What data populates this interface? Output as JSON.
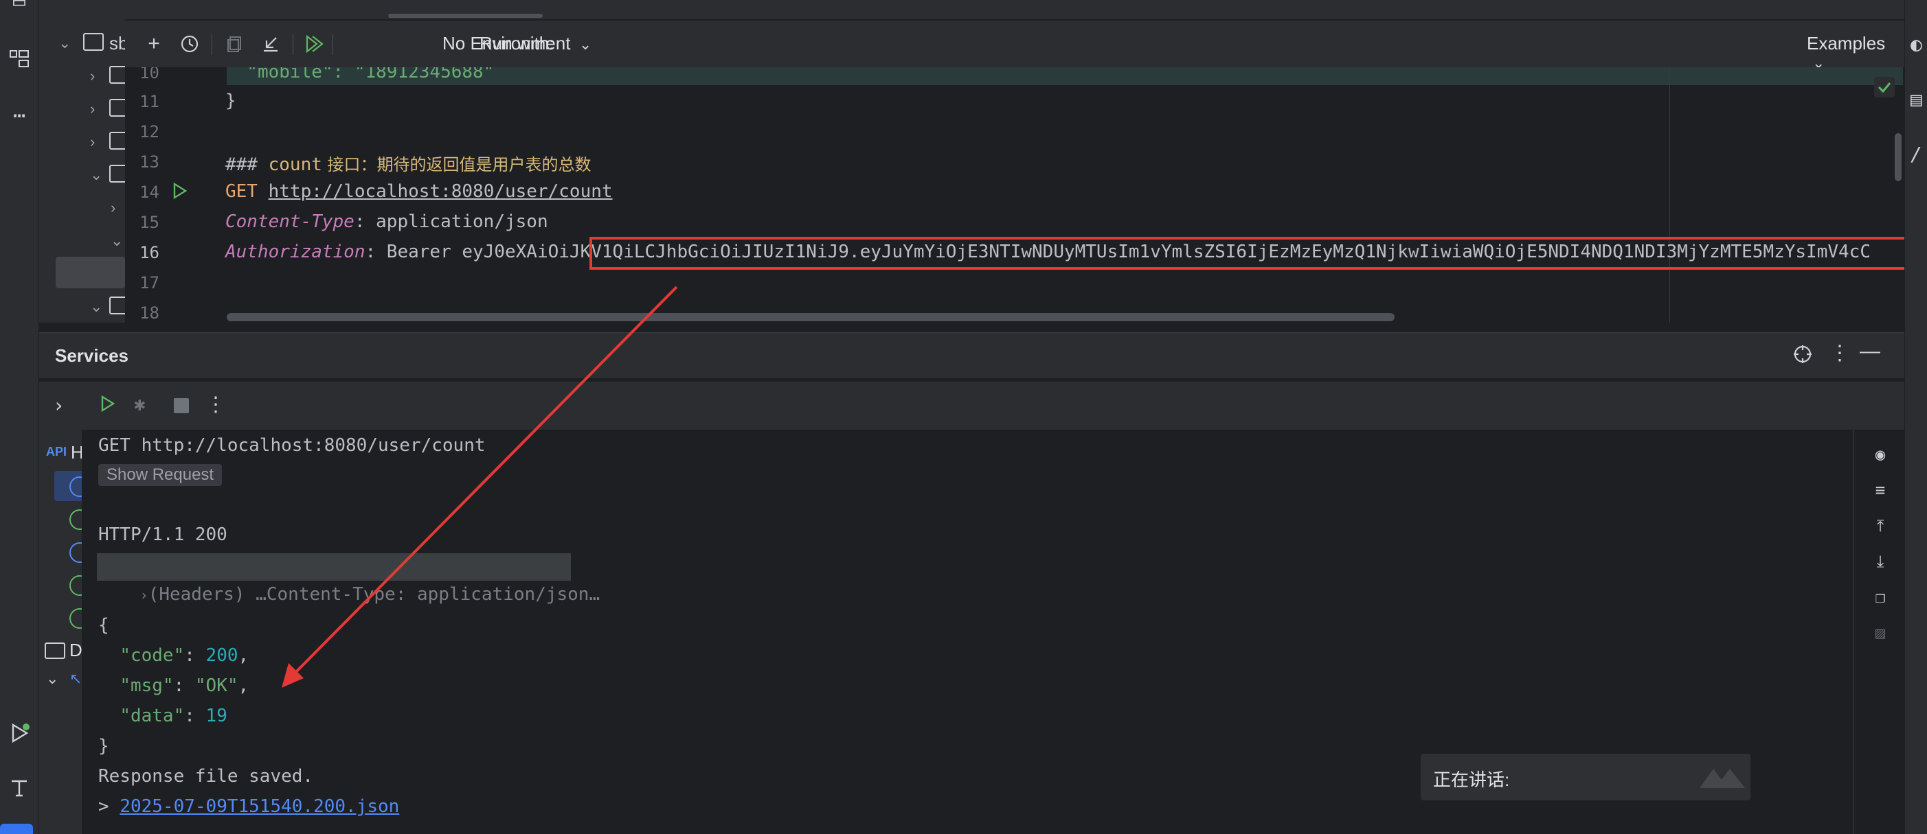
{
  "toolbar": {
    "run_with_label": "Run with:",
    "environment": "No Environment",
    "examples_label": "Examples"
  },
  "project_tree": {
    "root_label": "sb",
    "items": [
      {
        "label": "D"
      }
    ]
  },
  "editor": {
    "lines": [
      {
        "num": "10",
        "text": "  \"mobile\": \"18912345688\""
      },
      {
        "num": "11",
        "text": "}"
      },
      {
        "num": "12",
        "text": ""
      },
      {
        "num": "13",
        "prefix": "### ",
        "keyword": "count",
        "comment": " 接口：期待的返回值是用户表的总数"
      },
      {
        "num": "14",
        "method": "GET",
        "url": "http://localhost:8080/user/count"
      },
      {
        "num": "15",
        "header_key": "Content-Type",
        "header_value": ": application/json"
      },
      {
        "num": "16",
        "header_key": "Authorization",
        "header_value": ": Bearer ",
        "token": "eyJ0eXAiOiJKV1QiLCJhbGciOiJIUzI1NiJ9.eyJuYmYiOjE3NTIwNDUyMTUsIm1vYmlsZSI6IjEzMzEyMzQ1NjkwIiwiaWQiOjE5NDI4NDQ1NDI3MjYzMTE5MzYsImV4cC"
      },
      {
        "num": "17",
        "text": ""
      },
      {
        "num": "18",
        "text": ""
      }
    ]
  },
  "services": {
    "title": "Services",
    "tree_label": "H"
  },
  "console": {
    "request_line": "GET http://localhost:8080/user/count",
    "show_request": "Show Request",
    "status_line": "HTTP/1.1 200",
    "headers_line": "(Headers) …Content-Type: application/json…",
    "brace_open": "{",
    "brace_close": "}",
    "json": [
      {
        "key": "\"code\"",
        "value": "200",
        "type": "num",
        "trail": ","
      },
      {
        "key": "\"msg\"",
        "value": "\"OK\"",
        "type": "str",
        "trail": ","
      },
      {
        "key": "\"data\"",
        "value": "19",
        "type": "num",
        "trail": ""
      }
    ],
    "saved_text": "Response file saved.",
    "file_prefix": "> ",
    "file_link": "2025-07-09T151540.200.json"
  },
  "overlay": {
    "talking": "正在讲话:"
  },
  "colors": {
    "highlight_box": "#e53935",
    "arrow": "#e53935"
  }
}
